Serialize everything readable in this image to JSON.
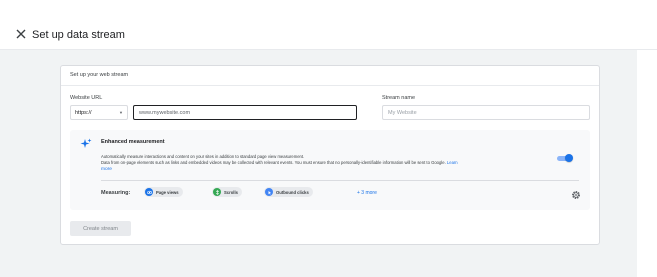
{
  "header": {
    "title": "Set up data stream"
  },
  "card": {
    "title": "Set up your web stream",
    "website_url": {
      "label": "Website URL",
      "protocol": "https://",
      "placeholder": "www.mywebsite.com"
    },
    "stream_name": {
      "label": "Stream name",
      "placeholder": "My Website"
    },
    "enhanced": {
      "title": "Enhanced measurement",
      "description_line1": "Automatically measure interactions and content on your sites in addition to standard page view measurement.",
      "description_line2": "Data from on-page elements such as links and embedded videos may be collected with relevant events. You must ensure that no personally-identifiable information will be sent to Google.",
      "learn_more_part1": "Learn",
      "learn_more_part2": "more",
      "enabled": true,
      "measuring_label": "Measuring:",
      "chips": [
        {
          "label": "Page views",
          "icon": "eye-icon",
          "color": "#1a73e8"
        },
        {
          "label": "Scrolls",
          "icon": "scroll-icon",
          "color": "#34a853"
        },
        {
          "label": "Outbound clicks",
          "icon": "cursor-click-icon",
          "color": "#4285f4"
        }
      ],
      "more_label": "+ 3 more"
    },
    "create_button": "Create stream"
  },
  "colors": {
    "accent": "#1a73e8",
    "green": "#34a853",
    "panel_bg": "#f8f9fa",
    "page_bg": "#f1f3f4"
  }
}
